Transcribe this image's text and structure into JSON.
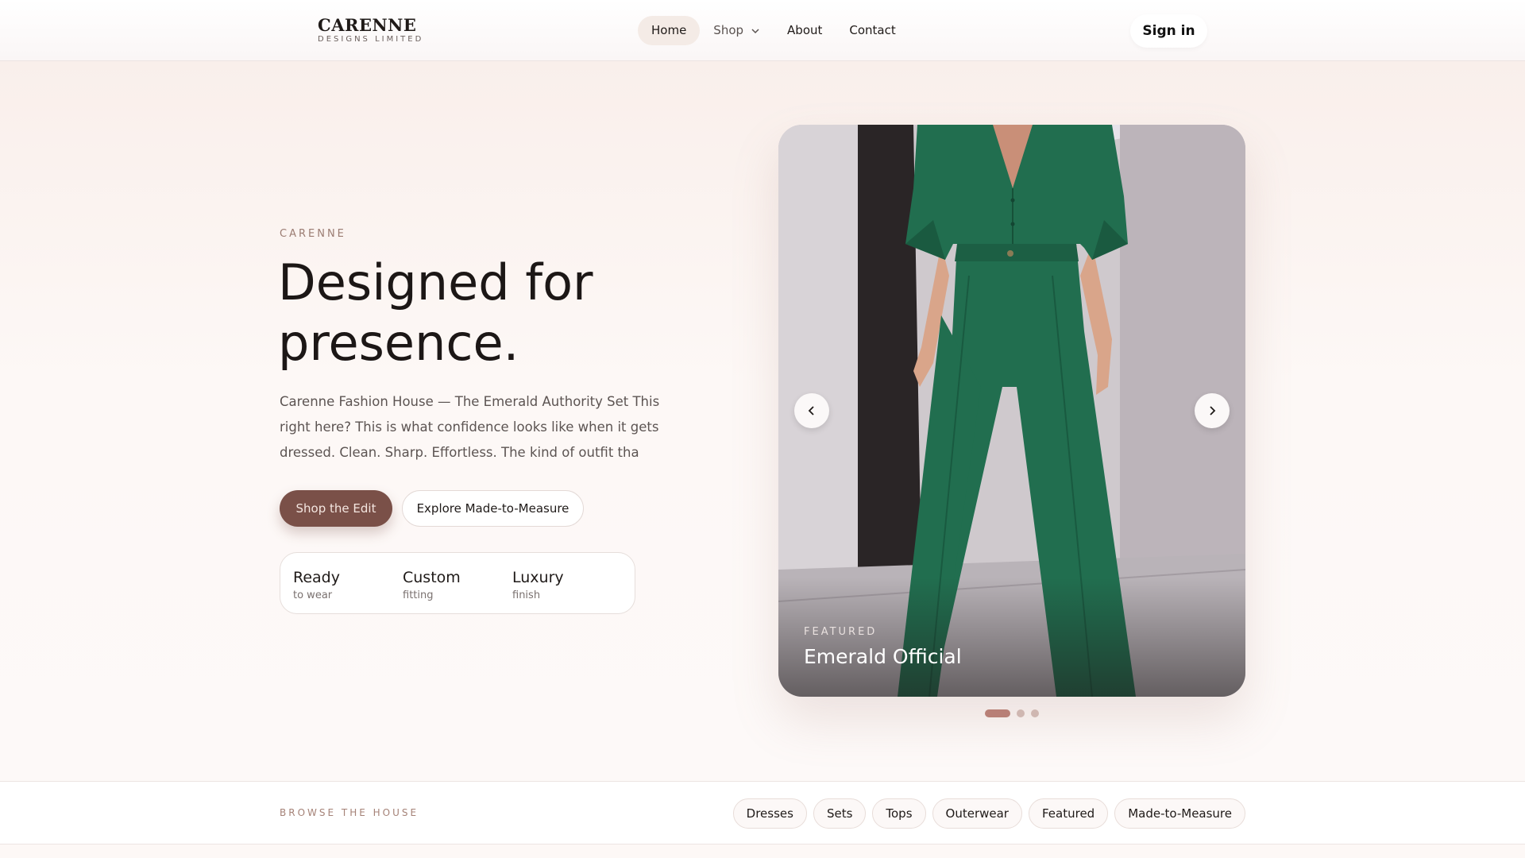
{
  "header": {
    "logo_name": "CARENNE",
    "logo_sub": "DESIGNS LIMITED",
    "nav": [
      {
        "label": "Home",
        "active": true
      },
      {
        "label": "Shop",
        "has_dropdown": true
      },
      {
        "label": "About"
      },
      {
        "label": "Contact"
      }
    ],
    "signin_label": "Sign in"
  },
  "hero": {
    "kicker": "CARENNE",
    "headline": "Designed for presence.",
    "lede": "Carenne Fashion House — The Emerald Authority Set This right here? This is what confidence looks like when it gets dressed. Clean. Sharp. Effortless. The kind of outfit tha",
    "primary_cta": "Shop the Edit",
    "secondary_cta": "Explore Made-to-Measure",
    "features": [
      {
        "title": "Ready",
        "sub": "to wear"
      },
      {
        "title": "Custom",
        "sub": "fitting"
      },
      {
        "title": "Luxury",
        "sub": "finish"
      }
    ]
  },
  "carousel": {
    "caption_kicker": "FEATURED",
    "caption_title": "Emerald Official",
    "slide_count": 3,
    "active_slide": 1,
    "prev_icon": "chevron-left-icon",
    "next_icon": "chevron-right-icon"
  },
  "browse": {
    "label": "BROWSE THE HOUSE",
    "chips": [
      "Dresses",
      "Sets",
      "Tops",
      "Outerwear",
      "Featured",
      "Made-to-Measure"
    ]
  },
  "colors": {
    "accent": "#7a5048",
    "emerald": "#1f6b4c",
    "page_bg": "#fdf8f6"
  }
}
